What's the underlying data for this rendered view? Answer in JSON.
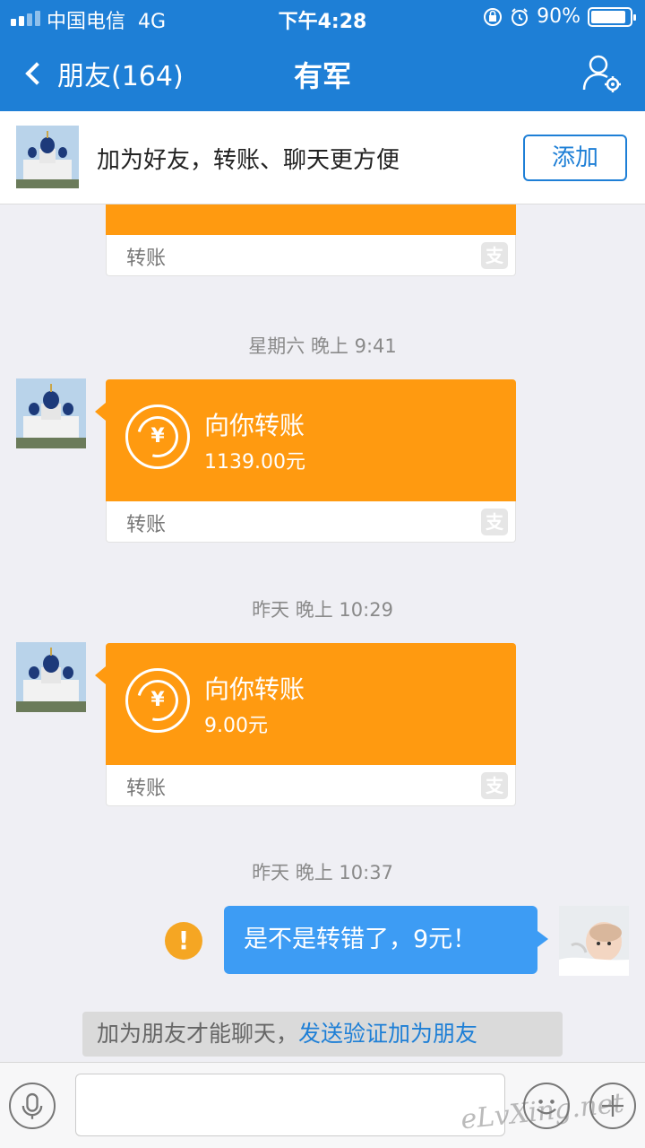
{
  "status_bar": {
    "carrier": "中国电信",
    "network": "4G",
    "time": "下午4:28",
    "battery": "90%",
    "battery_level": 0.9
  },
  "nav": {
    "back_label": "朋友(164)",
    "title": "有军"
  },
  "banner": {
    "text": "加为好友，转账、聊天更方便",
    "add_button": "添加"
  },
  "messages": {
    "partial_card": {
      "type_label": "转账",
      "badge": "支"
    },
    "ts1": "星期六 晚上 9:41",
    "card1": {
      "title": "向你转账",
      "amount": "1139.00元",
      "type_label": "转账",
      "badge": "支",
      "currency": "¥"
    },
    "ts2": "昨天 晚上 10:29",
    "card2": {
      "title": "向你转账",
      "amount": "9.00元",
      "type_label": "转账",
      "badge": "支",
      "currency": "¥"
    },
    "ts3": "昨天 晚上 10:37",
    "my_message": "是不是转错了，9元！",
    "warn_glyph": "!"
  },
  "notice": {
    "text": "加为朋友才能聊天，",
    "link": "发送验证加为朋友"
  },
  "watermark": "eLvXing.net",
  "colors": {
    "nav": "#1e7fd6",
    "transfer": "#ff9a10",
    "my_bubble": "#3d9cf4",
    "warning": "#f5a623"
  },
  "icons": [
    "mic-icon",
    "emoji-icon",
    "plus-icon",
    "settings-user-icon",
    "back-chevron-icon",
    "transfer-yen-icon",
    "alipay-icon",
    "warning-icon"
  ]
}
